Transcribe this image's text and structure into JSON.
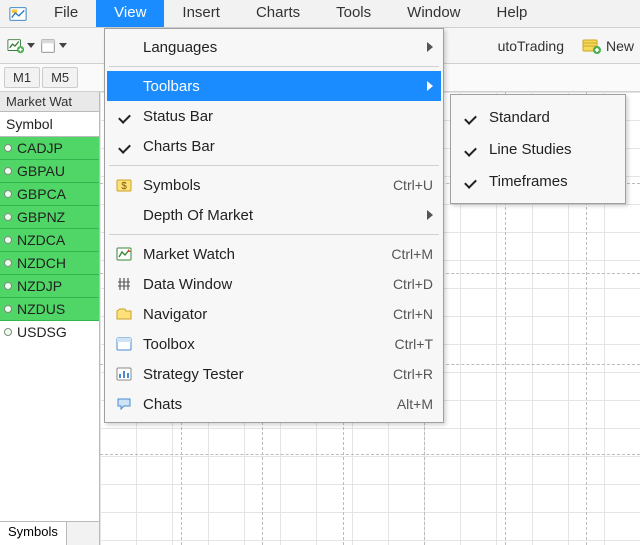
{
  "menubar": {
    "items": [
      {
        "label": "File"
      },
      {
        "label": "View",
        "active": true
      },
      {
        "label": "Insert"
      },
      {
        "label": "Charts"
      },
      {
        "label": "Tools"
      },
      {
        "label": "Window"
      },
      {
        "label": "Help"
      }
    ]
  },
  "toolstrip": {
    "autotrading_fragment": "utoTrading",
    "new_fragment": "New"
  },
  "timeframes": [
    "M1",
    "M5"
  ],
  "market_watch": {
    "title": "Market Wat",
    "col": "Symbol",
    "symbols": [
      "CADJP",
      "GBPAU",
      "GBPCA",
      "GBPNZ",
      "NZDCA",
      "NZDCH",
      "NZDJP",
      "NZDUS",
      "USDSG"
    ],
    "tab": "Symbols"
  },
  "view_menu": {
    "languages": "Languages",
    "toolbars": "Toolbars",
    "status_bar": "Status Bar",
    "charts_bar": "Charts Bar",
    "symbols": "Symbols",
    "symbols_accel": "Ctrl+U",
    "depth": "Depth Of Market",
    "market_watch": "Market Watch",
    "market_watch_accel": "Ctrl+M",
    "data_window": "Data Window",
    "data_window_accel": "Ctrl+D",
    "navigator": "Navigator",
    "navigator_accel": "Ctrl+N",
    "toolbox": "Toolbox",
    "toolbox_accel": "Ctrl+T",
    "strategy_tester": "Strategy Tester",
    "strategy_tester_accel": "Ctrl+R",
    "chats": "Chats",
    "chats_accel": "Alt+M"
  },
  "toolbars_submenu": {
    "standard": "Standard",
    "line_studies": "Line Studies",
    "timeframes": "Timeframes"
  }
}
